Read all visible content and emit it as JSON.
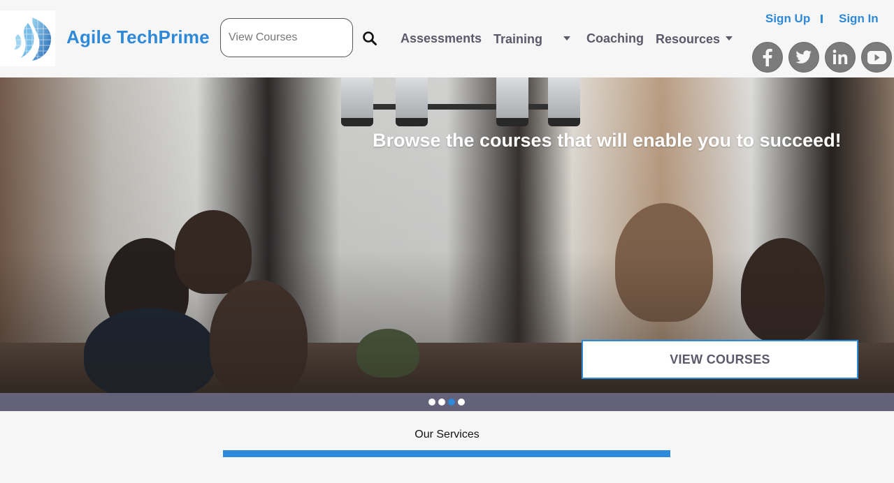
{
  "header": {
    "brand": "Agile TechPrime",
    "logo_icon": "globe-grid-logo",
    "search": {
      "placeholder": "View Courses",
      "value": "",
      "icon": "search-icon"
    },
    "nav": [
      {
        "label": "Assessments"
      },
      {
        "label": "Training",
        "dropdown": true
      },
      {
        "label": "Coaching"
      },
      {
        "label": "Resources",
        "dropdown": true
      }
    ],
    "auth": {
      "sign_up": "Sign Up",
      "sign_in": "Sign In"
    },
    "social": [
      "facebook-icon",
      "twitter-icon",
      "linkedin-icon",
      "youtube-icon"
    ]
  },
  "hero": {
    "heading": "Browse the courses that will enable you to succeed!",
    "cta": "VIEW COURSES",
    "image": "people-working-in-cafe-photo"
  },
  "carousel": {
    "count": 4,
    "active_index": 2
  },
  "services": {
    "title": "Our Services"
  },
  "colors": {
    "accent": "#2e89d8",
    "nav_text": "#5a5a6a",
    "strip": "#646278",
    "background": "#f6f6f6"
  }
}
